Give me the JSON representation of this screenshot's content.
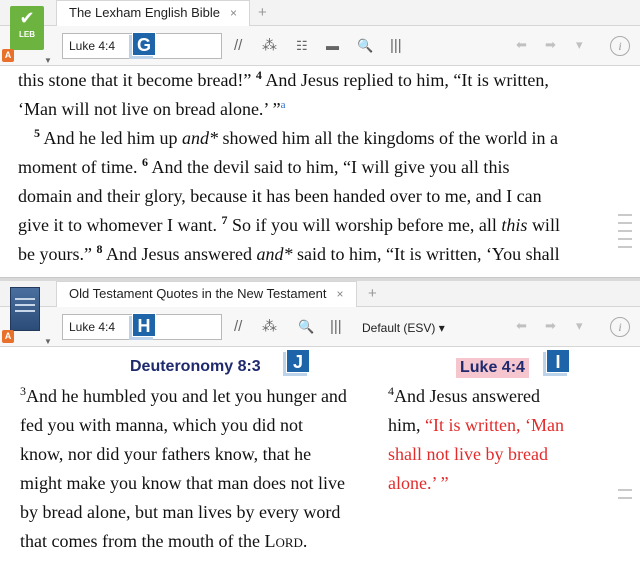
{
  "panel1": {
    "tab_title": "The Lexham English Bible",
    "tab_close": "×",
    "new_tab": "+",
    "logo_label": "LEB",
    "badge": "A",
    "reference": "Luke 4:4",
    "marker": "G",
    "text_lines": [
      {
        "segments": [
          {
            "t": "this stone that it become bread!” "
          },
          {
            "v": "4"
          },
          {
            "t": " And Jesus replied to him, “It is written,"
          }
        ]
      },
      {
        "segments": [
          {
            "t": "‘Man will not live on bread alone.’ ”"
          },
          {
            "f": "a"
          }
        ]
      },
      {
        "indent": true,
        "segments": [
          {
            "v": "5"
          },
          {
            "t": " And he led him up "
          },
          {
            "i": "and*"
          },
          {
            "t": " showed him all the kingdoms of the world in a"
          }
        ]
      },
      {
        "segments": [
          {
            "t": "moment of time. "
          },
          {
            "v": "6"
          },
          {
            "t": " And the devil said to him, “I will give you all this"
          }
        ]
      },
      {
        "segments": [
          {
            "t": "domain and their glory, because it has been handed over to me, and I can"
          }
        ]
      },
      {
        "segments": [
          {
            "t": "give it to whomever I want. "
          },
          {
            "v": "7"
          },
          {
            "t": " So if you will worship before me, all "
          },
          {
            "i": "this"
          },
          {
            "t": " will"
          }
        ]
      },
      {
        "segments": [
          {
            "t": "be yours.” "
          },
          {
            "v": "8"
          },
          {
            "t": " And Jesus answered "
          },
          {
            "i": "and*"
          },
          {
            "t": " said to him, “It is written, ‘You shall"
          }
        ]
      }
    ]
  },
  "panel2": {
    "tab_title": "Old Testament Quotes in the New Testament",
    "tab_close": "×",
    "new_tab": "+",
    "badge": "A",
    "reference": "Luke 4:4",
    "marker": "H",
    "version": "Default (ESV) ▾",
    "ot_heading": "Deuteronomy 8:3",
    "ot_marker": "J",
    "nt_heading": "Luke 4:4",
    "nt_marker": "I",
    "ot_lines": [
      {
        "segments": [
          {
            "v": "3"
          },
          {
            "t": "And he humbled you and let you hunger and"
          }
        ]
      },
      {
        "segments": [
          {
            "t": "fed you with manna, which you did not"
          }
        ]
      },
      {
        "segments": [
          {
            "t": "know, nor did your fathers know, that he"
          }
        ]
      },
      {
        "segments": [
          {
            "t": "might make you know that man does not live"
          }
        ]
      },
      {
        "segments": [
          {
            "t": "by bread alone, but man lives by every word"
          }
        ]
      },
      {
        "segments": [
          {
            "t": "that comes from the mouth of the "
          },
          {
            "sc": "Lord"
          },
          {
            "t": "."
          }
        ]
      }
    ],
    "nt_lines": [
      {
        "segments": [
          {
            "v": "4"
          },
          {
            "t": "And Jesus answered"
          }
        ]
      },
      {
        "segments": [
          {
            "t": "him, "
          },
          {
            "r": "“It is written, ‘Man"
          }
        ]
      },
      {
        "segments": [
          {
            "r": "shall not live by bread"
          }
        ]
      },
      {
        "segments": [
          {
            "r": "alone.’ ”"
          }
        ]
      }
    ]
  },
  "toolbar": {
    "parallel_icon": "//",
    "visual_filter_icon": "⁂",
    "text_display_icon": "☷",
    "panel_menu_icon": "▬",
    "search_icon": "🔍",
    "columns_icon": "|||",
    "back_icon": "⬅",
    "forward_icon": "➡",
    "history_icon": "▾",
    "info_icon": "i"
  },
  "colors": {
    "marker": "#1e64a8",
    "luke_highlight": "#f6c6cf",
    "words_of_christ": "#e32b2b",
    "heading": "#1f2a6e",
    "leb_logo": "#6db33f"
  }
}
